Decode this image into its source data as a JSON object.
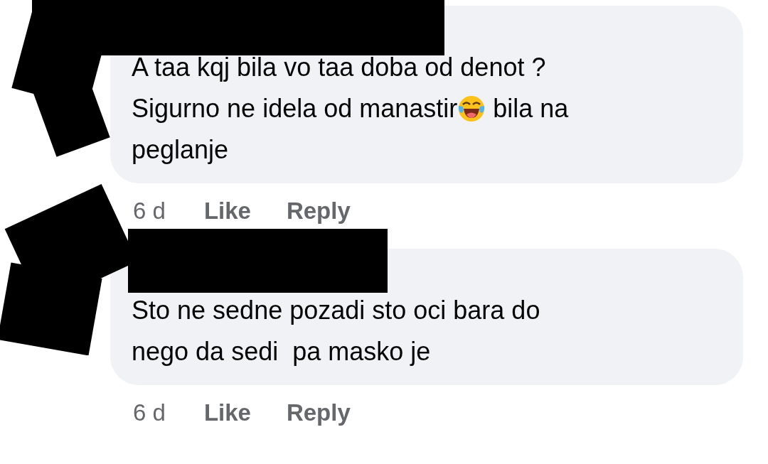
{
  "comments": [
    {
      "lines": [
        [
          {
            "kind": "text",
            "text": "A taa kqj bila vo taa doba od denot ?"
          }
        ],
        [
          {
            "kind": "text",
            "text": "Sigurno ne idela od manastir"
          },
          {
            "kind": "emoji"
          },
          {
            "kind": "text",
            "text": " bila na"
          }
        ],
        [
          {
            "kind": "text",
            "text": "peglanje"
          }
        ]
      ],
      "time": "6 d",
      "actions": [
        "Like",
        "Reply"
      ]
    },
    {
      "lines": [
        [
          {
            "kind": "text",
            "text": "Sto ne sedne pozadi sto oci bara do"
          }
        ],
        [
          {
            "kind": "text",
            "text": "nego da sedi  pa masko je"
          }
        ]
      ],
      "time": "6 d",
      "actions": [
        "Like",
        "Reply"
      ]
    }
  ]
}
